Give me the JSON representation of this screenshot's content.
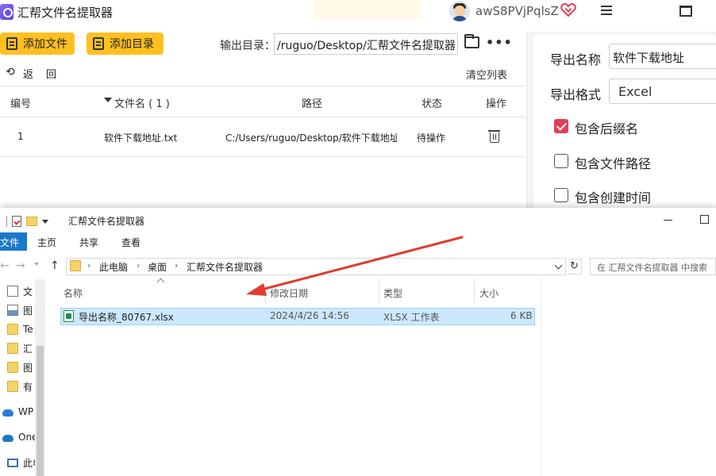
{
  "app": {
    "title": "汇帮文件名提取器",
    "username": "awS8PVjPqlsZ",
    "toolbar": {
      "add_file": "添加文件",
      "add_dir": "添加目录",
      "output_label": "输出目录：",
      "output_path": "/ruguo/Desktop/汇帮文件名提取器"
    },
    "subbar": {
      "back_arrow": "⟲",
      "back": "返",
      "return": "回",
      "clear": "清空列表"
    },
    "table": {
      "headers": {
        "index": "编号",
        "filename": "文件名 ( 1 )",
        "path": "路径",
        "status": "状态",
        "action": "操作"
      },
      "rows": [
        {
          "index": "1",
          "filename": "软件下载地址.txt",
          "path": "C:/Users/ruguo/Desktop/软件下载地址",
          "status": "待操作"
        }
      ]
    },
    "settings": {
      "export_name_label": "导出名称",
      "export_name_value": "软件下载地址",
      "export_format_label": "导出格式",
      "export_format_value": "Excel",
      "options": [
        {
          "label": "包含后缀名",
          "checked": true
        },
        {
          "label": "包含文件路径",
          "checked": false
        },
        {
          "label": "包含创建时间",
          "checked": false
        }
      ]
    },
    "colors": {
      "accent_yellow": "#ffc020",
      "check_red": "#e23e57"
    }
  },
  "explorer": {
    "title": "汇帮文件名提取器",
    "ribbon": {
      "file": "文件",
      "home": "主页",
      "share": "共享",
      "view": "查看"
    },
    "nav": {
      "back": "←",
      "forward": "→",
      "up": "↑",
      "refresh": "↻"
    },
    "breadcrumb": [
      "此电脑",
      "桌面",
      "汇帮文件名提取器"
    ],
    "crumb_separator": "›",
    "search_placeholder": "在 汇帮文件名提取器 中搜索",
    "sidebar": [
      "文",
      "图",
      "Te",
      "汇",
      "图",
      "有",
      "WP",
      "One",
      "此电"
    ],
    "columns": {
      "name": "名称",
      "date": "修改日期",
      "type": "类型",
      "size": "大小"
    },
    "files": [
      {
        "name": "导出名称_80767.xlsx",
        "date": "2024/4/26 14:56",
        "type": "XLSX 工作表",
        "size": "6 KB"
      }
    ],
    "colors": {
      "file_tab": "#1979ca",
      "selection": "#cce8ff",
      "annotation_arrow": "#e23b2e"
    }
  }
}
